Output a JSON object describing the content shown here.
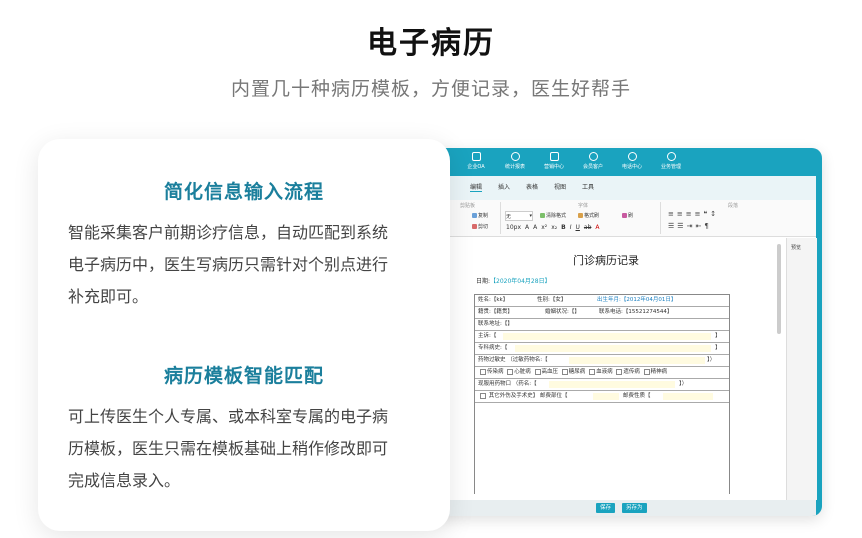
{
  "page": {
    "title": "电子病历",
    "subtitle": "内置几十种病历模板，方便记录，医生好帮手"
  },
  "card": {
    "section1_title": "简化信息输入流程",
    "section1_lines": [
      "智能采集客户前期诊疗信息，自动匹配到系统",
      "电子病历中，医生写病历只需针对个别点进行",
      "补充即可。"
    ],
    "section2_title": "病历模板智能匹配",
    "section2_lines": [
      "可上传医生个人专属、或本科室专属的电子病",
      "历模板，医生只需在模板基础上稍作修改即可",
      "完成信息录入。"
    ]
  },
  "app": {
    "nav": [
      "企业OA",
      "统计报表",
      "营销中心",
      "会员客户",
      "电话中心",
      "业务管理"
    ],
    "ribbon_tabs": [
      "编辑",
      "插入",
      "表格",
      "视图",
      "工具"
    ],
    "ribbon_group_clipboard": "剪贴板",
    "ribbon_group_font": "字体",
    "ribbon_group_paragraph": "段落",
    "ribbon_buttons": {
      "copy": "复制",
      "cut": "剪切",
      "clear_format": "清除格式",
      "format_brush": "格式刷",
      "brush": "刷",
      "font_size": "10px"
    },
    "font_select": "无",
    "side_panel": "预览",
    "footer_buttons": [
      "保存",
      "另存为"
    ]
  },
  "document": {
    "title": "门诊病历记录",
    "date_label": "日期:",
    "date_value": "【2020年04月28日】",
    "rows": {
      "name": "姓名:【kk】",
      "gender": "性别:【女】",
      "birth": "出生年月:【2012年04月01日】",
      "native": "籍贯:【籍贯】",
      "marital": "婚姻状况:【】",
      "phone": "联系电话:【15521274544】",
      "address": "联系地址:【】",
      "complaint": "主诉:【",
      "history": "专科病史:【",
      "allergy": "药物过敏史 （过敏药物名:【",
      "diseases": [
        "传染病",
        "心脏病",
        "高血压",
        "糖尿病",
        "血液病",
        "遗传病",
        "精神病"
      ],
      "medication": "现服用药物口 （药名:【",
      "surgery": "其它外伤及手术史】  邮费部位【",
      "surgery_nature": "邮费性质【"
    },
    "bracket_close": "】",
    "bracket_close_paren": "】）"
  }
}
